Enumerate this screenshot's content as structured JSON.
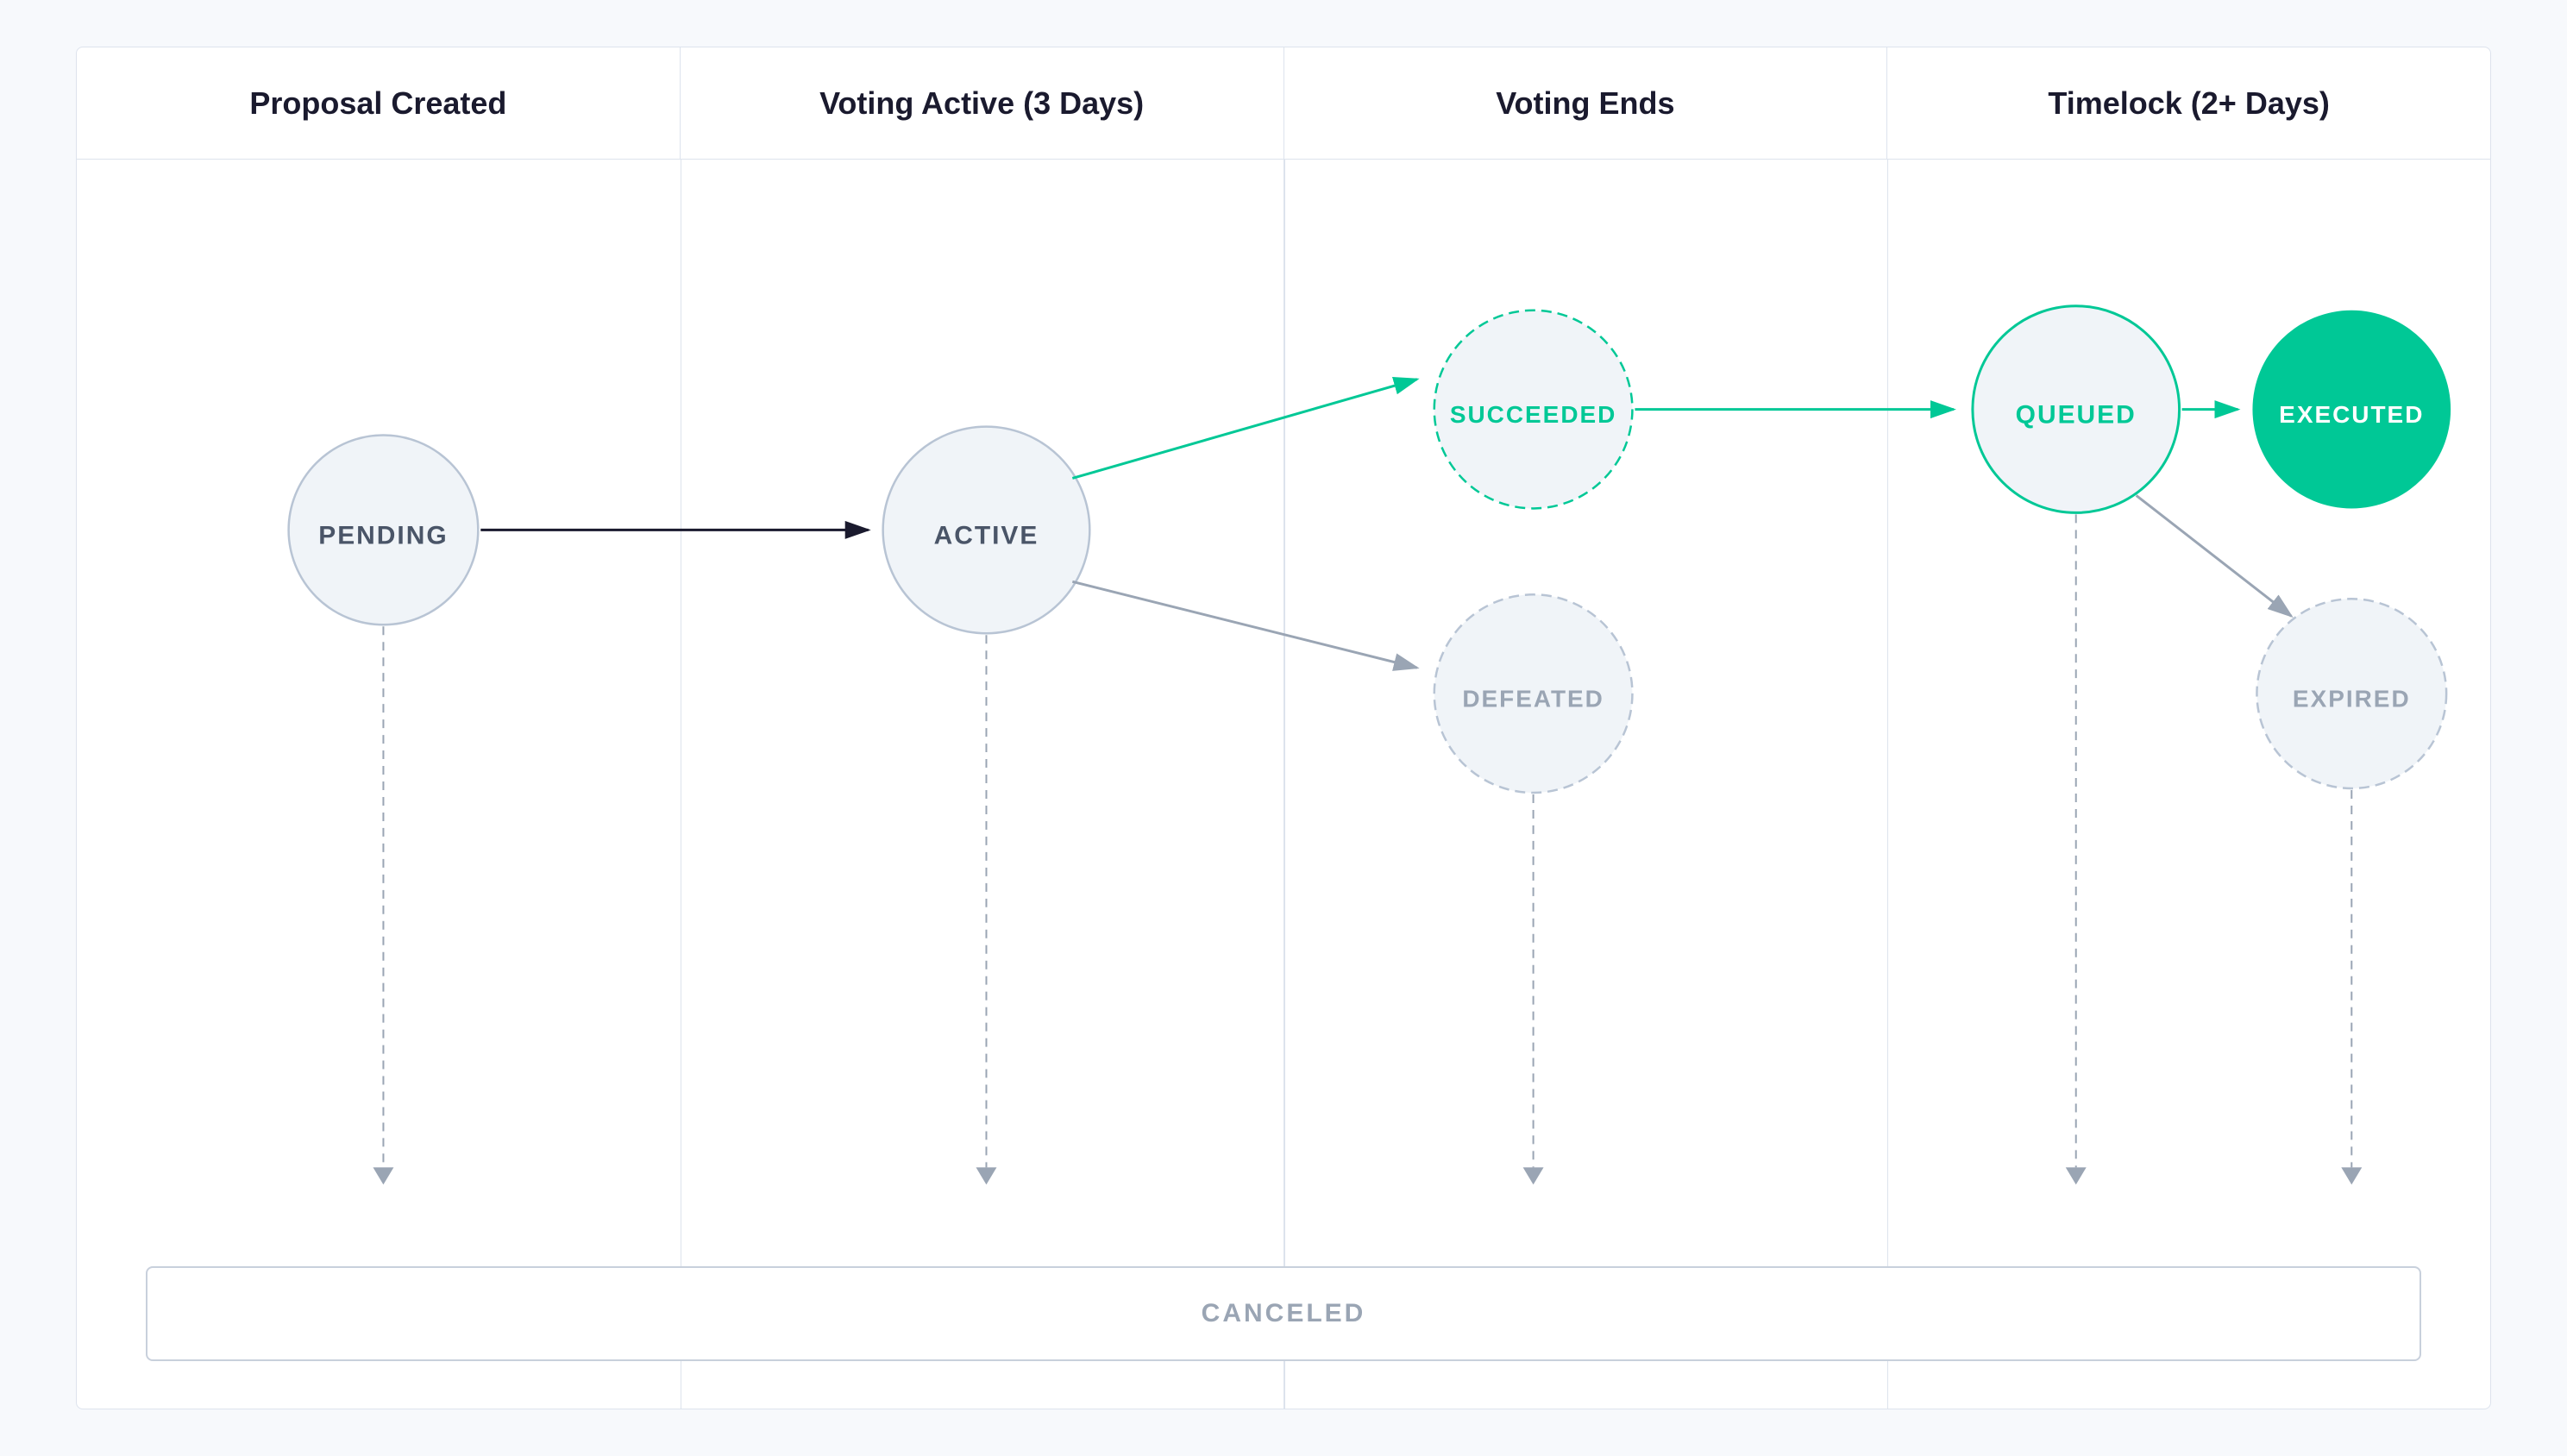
{
  "header": {
    "col1": "Proposal Created",
    "col2": "Voting Active (3 Days)",
    "col3": "Voting Ends",
    "col4": "Timelock (2+ Days)"
  },
  "states": {
    "pending": "PENDING",
    "active": "ACTIVE",
    "succeeded": "SUCCEEDED",
    "defeated": "DEFEATED",
    "queued": "QUEUED",
    "executed": "EXECUTED",
    "expired": "EXPIRED",
    "canceled": "CANCELED"
  },
  "colors": {
    "green": "#00c896",
    "green_dark": "#00b882",
    "gray_border": "#c8d0dc",
    "gray_text": "#9aa5b4",
    "black_arrow": "#1a1a2e",
    "col_divider": "#dde3ed",
    "circle_bg_light": "#f0f4f8",
    "circle_bg_green": "#00c896"
  }
}
